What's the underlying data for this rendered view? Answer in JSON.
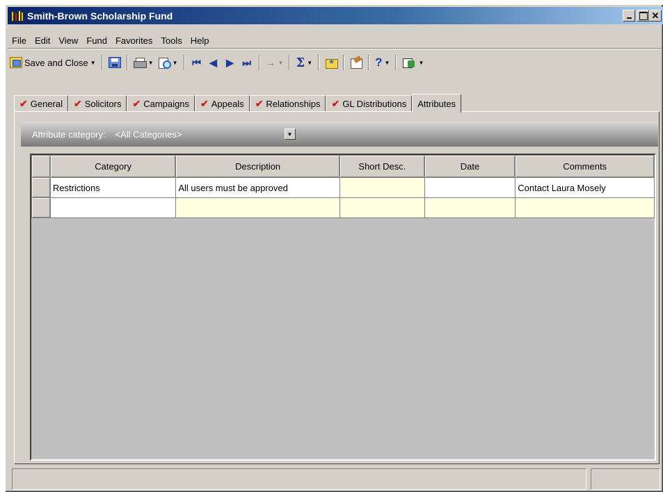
{
  "window": {
    "title": "Smith-Brown Scholarship Fund"
  },
  "menu": [
    "File",
    "Edit",
    "View",
    "Fund",
    "Favorites",
    "Tools",
    "Help"
  ],
  "toolbar": {
    "save_and_close_label": "Save and Close",
    "icons": [
      "save-and-close-icon",
      "save-icon",
      "print-icon",
      "print-preview-icon",
      "first-record-icon",
      "previous-record-icon",
      "next-record-icon",
      "last-record-icon",
      "go-to-icon",
      "sum-icon",
      "favorites-folder-icon",
      "properties-icon",
      "help-icon",
      "macro-icon"
    ]
  },
  "tabs": [
    {
      "label": "General",
      "checked": true
    },
    {
      "label": "Solicitors",
      "checked": true
    },
    {
      "label": "Campaigns",
      "checked": true
    },
    {
      "label": "Appeals",
      "checked": true
    },
    {
      "label": "Relationships",
      "checked": true
    },
    {
      "label": "GL Distributions",
      "checked": true
    },
    {
      "label": "Attributes",
      "checked": false,
      "active": true
    }
  ],
  "attribute_filter": {
    "label": "Attribute category:",
    "value": "<All Categories>"
  },
  "grid": {
    "columns": [
      "Category",
      "Description",
      "Short Desc.",
      "Date",
      "Comments"
    ],
    "rows": [
      {
        "category": "Restrictions",
        "description": "All users must be approved",
        "short_desc": "",
        "date": "",
        "comments": "Contact Laura Mosely"
      },
      {
        "category": "",
        "description": "",
        "short_desc": "",
        "date": "",
        "comments": ""
      }
    ]
  },
  "colors": {
    "title_bar": "#0a246a",
    "window_face": "#d4d0c8",
    "required_check": "#d02020",
    "grid_highlight": "#ffffe1"
  }
}
